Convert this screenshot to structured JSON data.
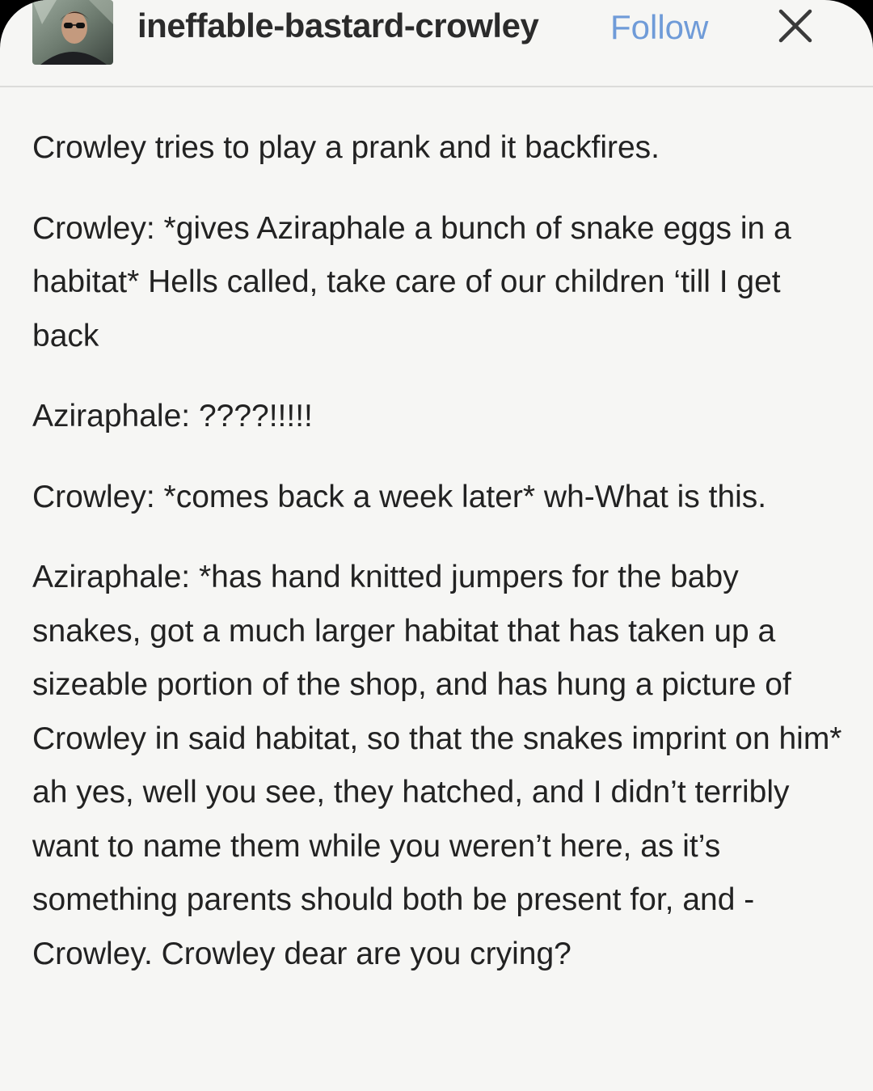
{
  "post": {
    "author": {
      "username": "ineffable-bastard-crowley"
    },
    "follow_label": "Follow",
    "paragraphs": [
      "Crowley tries to play a prank and it backfires.",
      "Crowley: *gives Aziraphale a bunch of snake eggs in a habitat* Hells called, take care of our children ‘till I get back",
      "Aziraphale: ????!!!!!",
      "Crowley: *comes back a week later* wh-What is this.",
      "Aziraphale: *has hand knitted jumpers for the baby snakes, got a much larger habitat that has taken up a sizeable portion of the shop, and has hung a picture of Crowley in said habitat, so that the snakes imprint on him* ah yes, well you see, they hatched, and I didn’t terribly want to name them while you weren’t here, as it’s something parents should both be present for, and - Crowley. Crowley dear are you crying?"
    ]
  },
  "icons": {
    "avatar": "avatar-image",
    "close": "close-icon"
  },
  "colors": {
    "background": "#f6f6f4",
    "text": "#222222",
    "username": "#2b2b2b",
    "follow": "#6f9bd8",
    "divider": "#dcdcda"
  }
}
